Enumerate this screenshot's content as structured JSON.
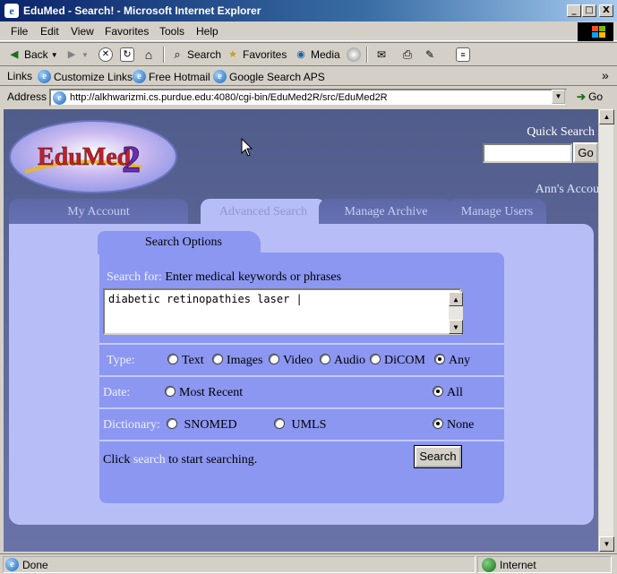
{
  "window": {
    "title": "EduMed - Search! - Microsoft Internet Explorer",
    "app_icon_glyph": "e",
    "buttons": {
      "minimize": "_",
      "maximize": "□",
      "close": "X"
    }
  },
  "menu": [
    "File",
    "Edit",
    "View",
    "Favorites",
    "Tools",
    "Help"
  ],
  "toolbar": {
    "back": "Back",
    "search": "Search",
    "favorites": "Favorites",
    "media": "Media"
  },
  "links": {
    "label": "Links",
    "items": [
      "Customize Links",
      "Free Hotmail",
      "Google Search APS"
    ],
    "overflow": "»"
  },
  "address": {
    "label": "Address",
    "url": "http://alkhwarizmi.cs.purdue.edu:4080/cgi-bin/EduMed2R/src/EduMed2R",
    "go": "Go"
  },
  "page": {
    "logo": {
      "text": "EduMed",
      "number": "2"
    },
    "quick_search": {
      "label": "Quick Search",
      "value": "",
      "go": "Go"
    },
    "account_link": "Ann's Account",
    "tabs": [
      "My Account",
      "Advanced Search",
      "Manage Archive",
      "Manage Users"
    ],
    "active_tab": "Advanced Search",
    "search_options": {
      "title": "Search Options",
      "search_for_label": "Search for:",
      "search_for_hint": "Enter medical keywords or phrases",
      "keywords": "diabetic retinopathies laser |",
      "type": {
        "label": "Type:",
        "options": [
          "Text",
          "Images",
          "Video",
          "Audio",
          "DiCOM",
          "Any"
        ],
        "selected": "Any"
      },
      "date": {
        "label": "Date:",
        "options": [
          "Most Recent",
          "All"
        ],
        "selected": "All"
      },
      "dictionary": {
        "label": "Dictionary:",
        "options": [
          "SNOMED",
          "UMLS",
          "None"
        ],
        "selected": "None"
      },
      "footer": {
        "prefix": "Click",
        "link": "search",
        "suffix": "to start searching."
      },
      "search_button": "Search"
    }
  },
  "status": {
    "text": "Done",
    "zone": "Internet"
  },
  "colors": {
    "page_bg": "#5d6799",
    "panel": "#b7bef7",
    "options_box": "#8b97f1",
    "titlebar": "#0a246a"
  }
}
